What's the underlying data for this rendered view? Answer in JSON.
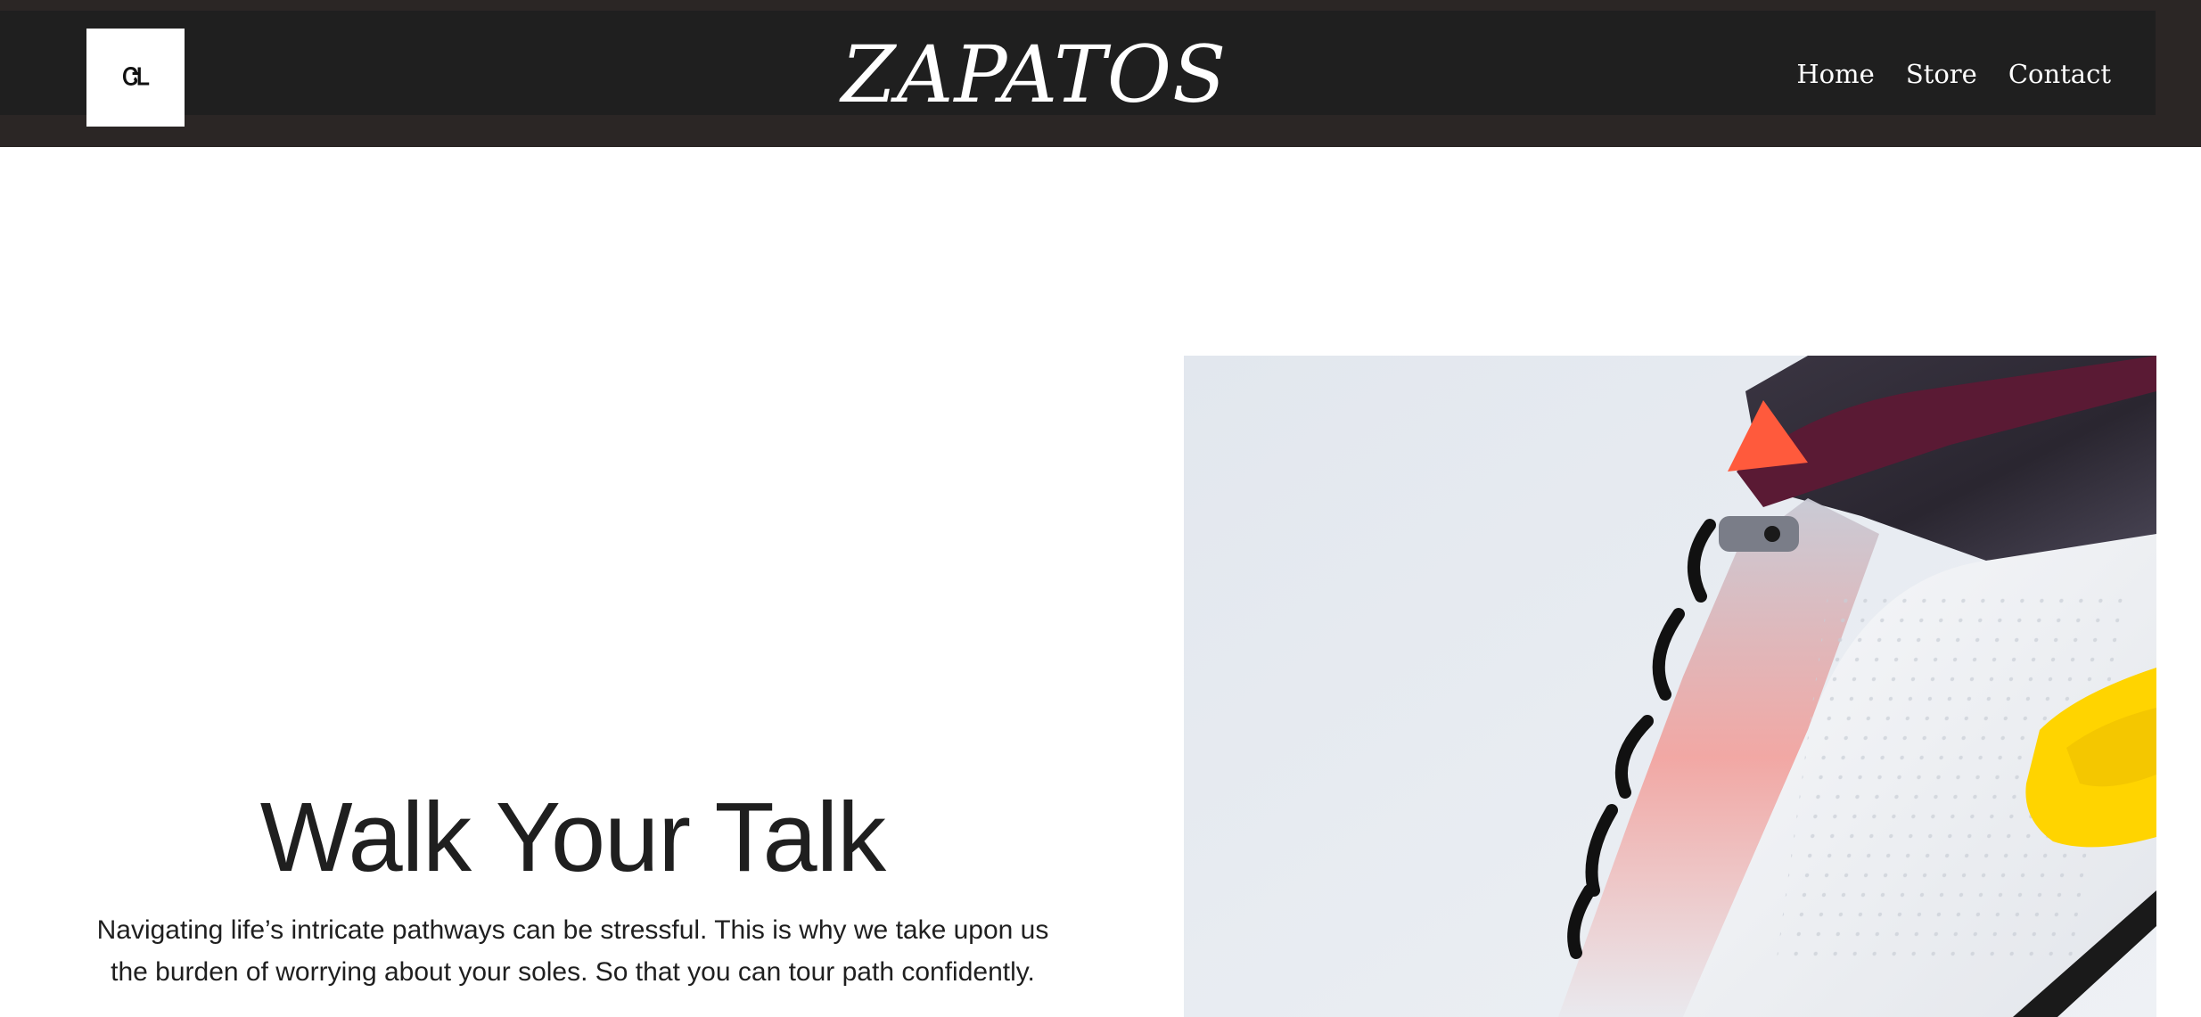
{
  "header": {
    "logo_text": "ᏣᏞ",
    "brand": "ZAPATOS",
    "nav": [
      {
        "label": "Home"
      },
      {
        "label": "Store"
      },
      {
        "label": "Contact"
      }
    ]
  },
  "hero": {
    "title": "Walk Your Talk",
    "text": "Navigating life’s intricate pathways can be stressful. This is why we take upon us the burden of worrying about your soles. So that you can tour path confidently.",
    "image": {
      "subject": "sneaker-photo",
      "colors": {
        "background": "#e8ecf1",
        "upper_dark": "#2a2630",
        "collar": "#5a1a34",
        "tongue_accent": "#ff5a3c",
        "air_unit": "#ffd400",
        "sole": "#f3f5f8",
        "laces": "#111111"
      }
    }
  }
}
